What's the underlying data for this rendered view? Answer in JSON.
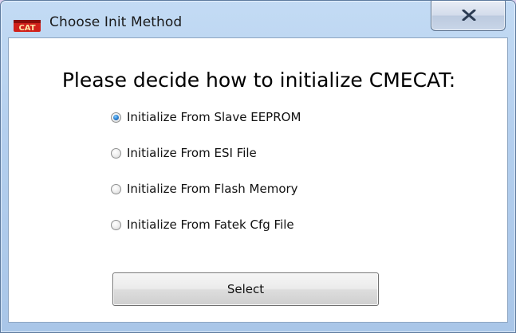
{
  "window": {
    "title": "Choose Init Method",
    "icon_text": "CAT"
  },
  "heading": "Please decide how to initialize CMECAT:",
  "options": [
    {
      "label": "Initialize From Slave EEPROM",
      "checked": true
    },
    {
      "label": "Initialize From ESI File",
      "checked": false
    },
    {
      "label": "Initialize From Flash Memory",
      "checked": false
    },
    {
      "label": "Initialize From Fatek Cfg File",
      "checked": false
    }
  ],
  "select_button": {
    "label": "Select"
  },
  "colors": {
    "titlebar": "#b4cfee",
    "radio_checked": "#2f86d6",
    "icon_red": "#d0201a"
  },
  "icons": {
    "app": "cat-app-icon",
    "close": "close-icon"
  }
}
